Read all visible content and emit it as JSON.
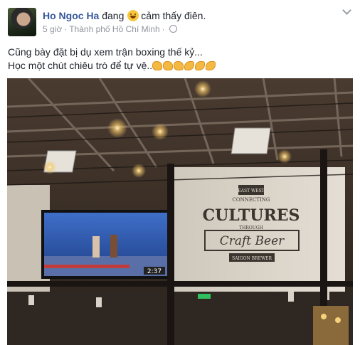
{
  "post": {
    "author": "Ho Ngoc Ha",
    "activity_prefix": "đang",
    "feeling_icon": "laughing-face-icon",
    "activity_suffix": "cảm thấy điên.",
    "time": "5 giờ",
    "separator": "·",
    "location": "Thành phố Hồ Chí Minh",
    "audience_icon": "globe-icon",
    "line1": "Cũng bày đặt bị dụ xem trận boxing thế kỷ...",
    "line2": "Học một chút chiêu trò để tự vệ..",
    "line2_emojis": [
      "fist-icon",
      "fist-icon",
      "fist-icon",
      "flexed-bicep-icon",
      "flexed-bicep-icon",
      "flexed-bicep-icon"
    ]
  },
  "photo": {
    "sign_top": "EAST WEST",
    "sign_connecting": "CONNECTING",
    "sign_cultures": "CULTURES",
    "sign_through": "THROUGH",
    "sign_craft": "Craft Beer",
    "sign_brewer": "SAIGON BREWER",
    "tv_clock": "2:37",
    "colors": {
      "ceiling": "#3a2e26",
      "wall": "#d9d3c8",
      "tv_blue": "#2f5fb5"
    }
  }
}
